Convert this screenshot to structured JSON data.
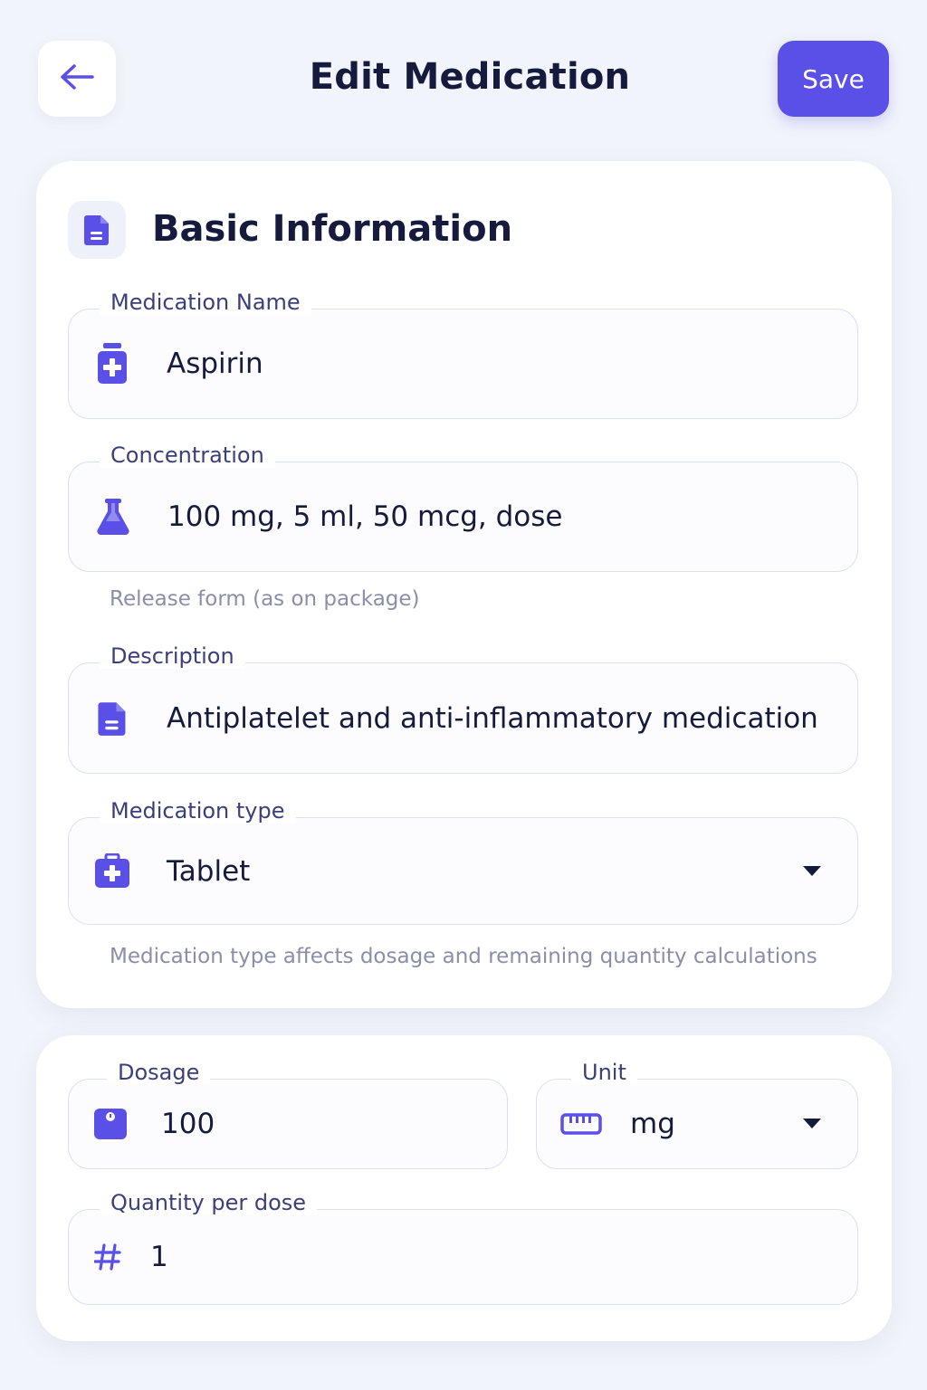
{
  "header": {
    "title": "Edit Medication",
    "save_label": "Save",
    "back_icon": "arrow-left-icon"
  },
  "basic_info": {
    "title": "Basic Information",
    "icon": "document-icon",
    "fields": {
      "name": {
        "label": "Medication Name",
        "value": "Aspirin",
        "icon": "medicine-bottle-icon"
      },
      "concentration": {
        "label": "Concentration",
        "value": "100 mg, 5 ml, 50 mcg, dose",
        "icon": "flask-icon",
        "helper": "Release form (as on package)"
      },
      "description": {
        "label": "Description",
        "value": "Antiplatelet and anti-inflammatory medication",
        "icon": "document-icon"
      },
      "type": {
        "label": "Medication type",
        "value": "Tablet",
        "icon": "first-aid-kit-icon",
        "helper": "Medication type affects dosage and remaining quantity calculations"
      }
    }
  },
  "dosage_info": {
    "dosage": {
      "label": "Dosage",
      "value": "100",
      "icon": "scale-icon"
    },
    "unit": {
      "label": "Unit",
      "value": "mg",
      "icon": "ruler-icon"
    },
    "quantity": {
      "label": "Quantity per dose",
      "value": "1",
      "icon": "hash-icon"
    }
  },
  "colors": {
    "accent": "#5a4fe6",
    "background": "#f2f4fb",
    "card": "#ffffff",
    "text": "#161a3c",
    "label": "#3b3f7a",
    "helper": "#8a8ea8",
    "border": "#dcdff0"
  }
}
